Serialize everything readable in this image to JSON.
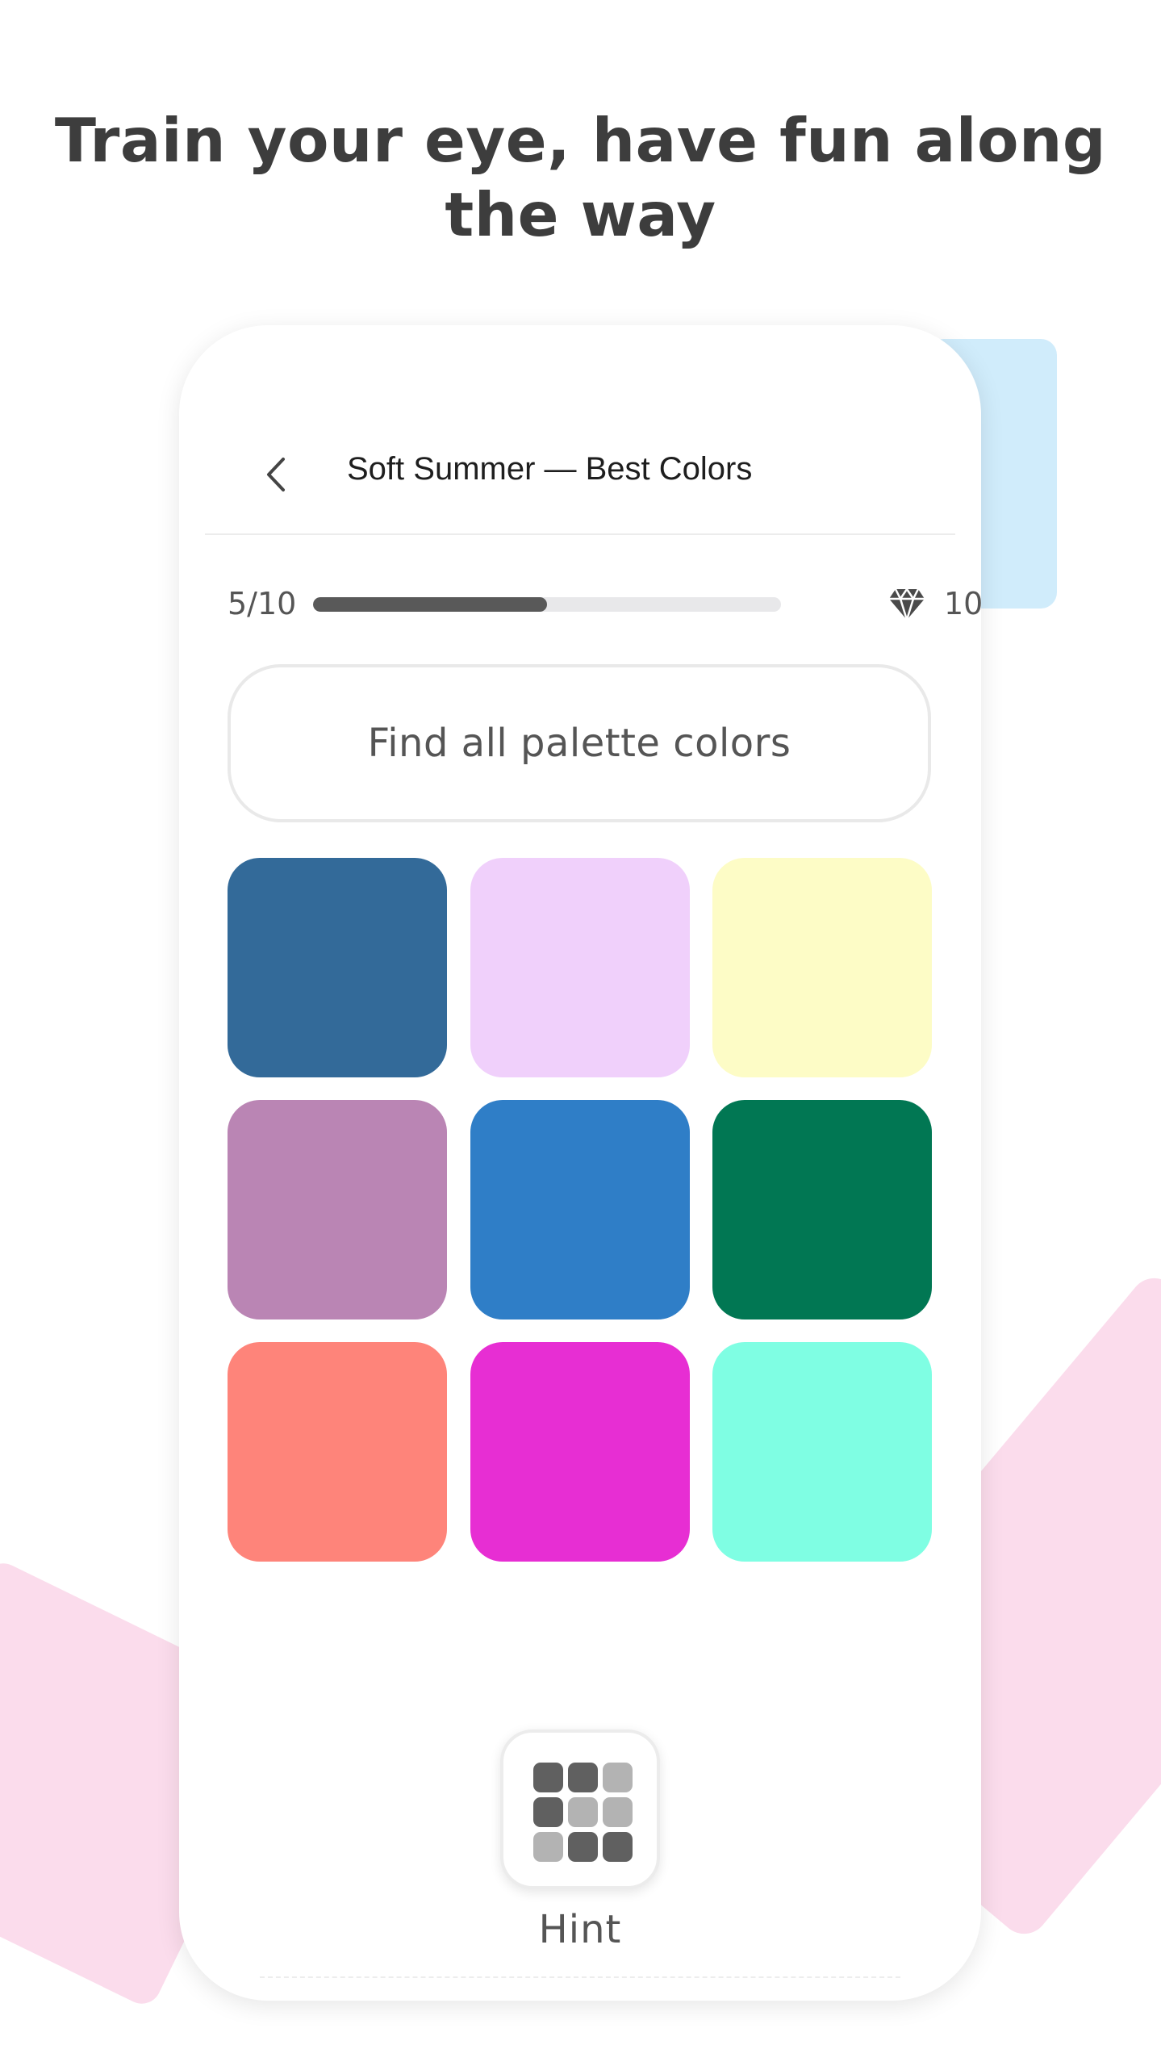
{
  "headline": "Train your eye, have fun along the way",
  "nav": {
    "title": "Soft Summer — Best Colors",
    "back_icon": "chevron-left-icon"
  },
  "progress": {
    "label": "5/10",
    "fraction": 0.5
  },
  "gems": {
    "icon": "diamond-icon",
    "count": "10"
  },
  "task": {
    "instruction": "Find all palette colors"
  },
  "swatches": [
    "#336a99",
    "#f0d0fb",
    "#fdfcc6",
    "#ba85b4",
    "#2f7ec7",
    "#017753",
    "#fe847a",
    "#e72ed3",
    "#7ffee3"
  ],
  "hint": {
    "label": "Hint",
    "icon": "grid-icon"
  },
  "colors": {
    "pink_deco": "#fbdcec",
    "blue_deco": "#d0ecfb",
    "progress_fill": "#595959"
  }
}
